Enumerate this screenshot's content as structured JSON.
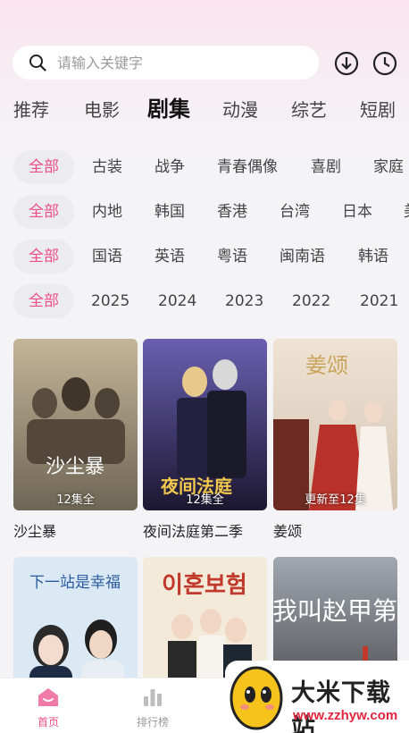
{
  "search": {
    "placeholder": "请输入关键字"
  },
  "nav_tabs": [
    {
      "label": "推荐"
    },
    {
      "label": "电影"
    },
    {
      "label": "剧集",
      "active": true
    },
    {
      "label": "动漫"
    },
    {
      "label": "综艺"
    },
    {
      "label": "短剧"
    }
  ],
  "filters": {
    "all_label": "全部",
    "genre": [
      "古装",
      "战争",
      "青春偶像",
      "喜剧",
      "家庭"
    ],
    "region": [
      "内地",
      "韩国",
      "香港",
      "台湾",
      "日本",
      "美"
    ],
    "language": [
      "国语",
      "英语",
      "粤语",
      "闽南语",
      "韩语"
    ],
    "year": [
      "2025",
      "2024",
      "2023",
      "2022",
      "2021"
    ]
  },
  "cards": [
    {
      "title": "沙尘暴",
      "badge": "12集全",
      "poster_text": "沙尘暴",
      "colors": [
        "#b9a98c",
        "#6e6554"
      ]
    },
    {
      "title": "夜间法庭第二季",
      "badge": "12集全",
      "poster_text": "夜间法庭",
      "colors": [
        "#5a4f9a",
        "#1c1730"
      ]
    },
    {
      "title": "姜颂",
      "badge": "更新至12集",
      "poster_text": "姜颂",
      "colors": [
        "#e7d7c6",
        "#9c3a2c"
      ]
    },
    {
      "title": "",
      "badge": "",
      "poster_text": "下一站是幸福",
      "colors": [
        "#dbe9f5",
        "#3a5a82"
      ]
    },
    {
      "title": "",
      "badge": "",
      "poster_text": "이혼보험",
      "colors": [
        "#f3ead9",
        "#c0392b"
      ]
    },
    {
      "title": "",
      "badge": "",
      "poster_text": "我叫赵甲第",
      "colors": [
        "#9aa0a8",
        "#3b3b3f"
      ]
    }
  ],
  "bottom_nav": [
    {
      "label": "首页",
      "icon": "home-icon",
      "active": true
    },
    {
      "label": "排行榜",
      "icon": "ranking-icon",
      "active": false
    }
  ],
  "watermark": {
    "name": "大米下载站",
    "url": "www.zzhyw.com"
  },
  "colors": {
    "accent": "#ec4f86",
    "chip_bg": "#ecebef"
  }
}
